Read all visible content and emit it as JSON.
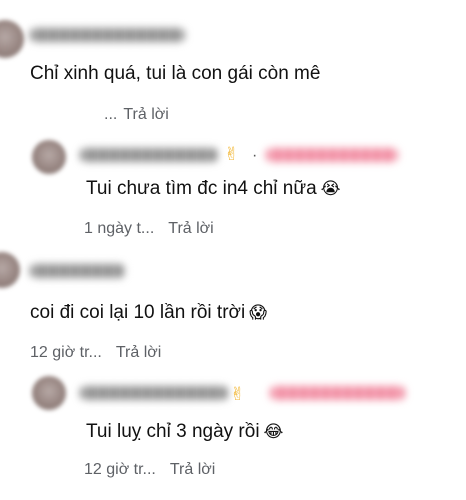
{
  "comments": [
    {
      "text": "Chỉ xinh quá, tui là con gái còn mê",
      "time": "...",
      "reply_label": "Trả lời"
    },
    {
      "badge": "✌",
      "separator": "·",
      "text": "Tui chưa tìm đc in4 chỉ nữa",
      "emoji": "😭",
      "time": "1 ngày t...",
      "reply_label": "Trả lời"
    },
    {
      "text": "coi đi coi lại 10 lần rồi trời",
      "emoji": "😱",
      "time": "12 giờ tr...",
      "reply_label": "Trả lời"
    },
    {
      "badge": "✌",
      "text": "Tui luỵ chỉ 3 ngày rồi",
      "emoji": "😂",
      "time": "12 giờ tr...",
      "reply_label": "Trả lời"
    }
  ]
}
